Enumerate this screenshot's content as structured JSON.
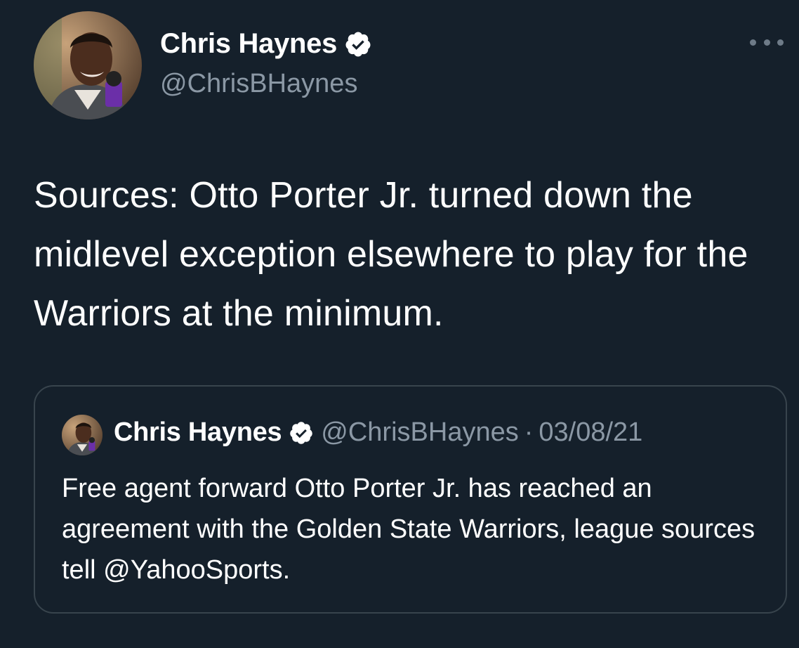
{
  "tweet": {
    "author": {
      "name": "Chris Haynes",
      "handle": "@ChrisBHaynes",
      "verified": true,
      "avatar_icon": "avatar-photo"
    },
    "text": "Sources: Otto Porter Jr. turned down the midlevel exception elsewhere to play for the Warriors at the minimum.",
    "more_icon": "more-options-icon"
  },
  "quoted_tweet": {
    "author": {
      "name": "Chris Haynes",
      "handle": "@ChrisBHaynes",
      "verified": true
    },
    "separator": "·",
    "date": "03/08/21",
    "text": "Free agent forward Otto Porter Jr. has reached an agreement with the Golden State Warriors, league sources tell @YahooSports."
  },
  "colors": {
    "background": "#15202b",
    "text": "#ffffff",
    "secondary_text": "#8b98a5",
    "border": "#38444d",
    "verified_badge": "#ffffff"
  }
}
